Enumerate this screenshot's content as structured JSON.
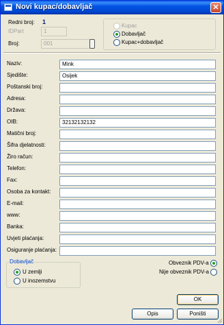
{
  "window": {
    "title": "Novi kupac/dobavljač",
    "close_glyph": "✕"
  },
  "header": {
    "redni_broj_label": "Redni broj:",
    "redni_broj_value": "1",
    "idpart_label": "IDPart",
    "idpart_value": "1",
    "broj_label": "Broj:",
    "broj_value": "001"
  },
  "type_group": {
    "options": [
      {
        "label": "Kupac",
        "checked": false,
        "enabled": false
      },
      {
        "label": "Dobavljač",
        "checked": true,
        "enabled": true
      },
      {
        "label": "Kupac+dobavljač",
        "checked": false,
        "enabled": true
      }
    ]
  },
  "fields": [
    {
      "label": "Naziv:",
      "value": "Mink"
    },
    {
      "label": "Sjedište:",
      "value": "Osijek"
    },
    {
      "label": "Poštanski broj:",
      "value": ""
    },
    {
      "label": "Adresa:",
      "value": ""
    },
    {
      "label": "Država:",
      "value": ""
    },
    {
      "label": "OIB:",
      "value": "32132132132"
    },
    {
      "label": "Matični broj:",
      "value": ""
    },
    {
      "label": "Šifra djelatnosti:",
      "value": ""
    },
    {
      "label": "Žiro račun:",
      "value": ""
    },
    {
      "label": "Telefon:",
      "value": ""
    },
    {
      "label": "Fax:",
      "value": ""
    },
    {
      "label": "Osoba za kontakt:",
      "value": ""
    },
    {
      "label": "E-mail:",
      "value": ""
    },
    {
      "label": "www:",
      "value": ""
    },
    {
      "label": "Banka:",
      "value": ""
    },
    {
      "label": "Uvjeti plaćanja:",
      "value": ""
    },
    {
      "label": "Osiguranje plaćanja:",
      "value": ""
    }
  ],
  "dobavljac_group": {
    "legend": "Dobavljač",
    "options": [
      {
        "label": "U zemlji",
        "checked": true
      },
      {
        "label": "U inozemstvu",
        "checked": false
      }
    ]
  },
  "pdv": {
    "options": [
      {
        "label": "Obveznik PDV-a",
        "checked": true
      },
      {
        "label": "Nije obveznik PDV-a",
        "checked": false
      }
    ]
  },
  "buttons": {
    "ok": "OK",
    "opis": "Opis",
    "ponisti": "Poništi"
  },
  "colors": {
    "title_bar": "#0054e3",
    "accent_blue": "#0a246a",
    "radio_check": "#21a121"
  }
}
